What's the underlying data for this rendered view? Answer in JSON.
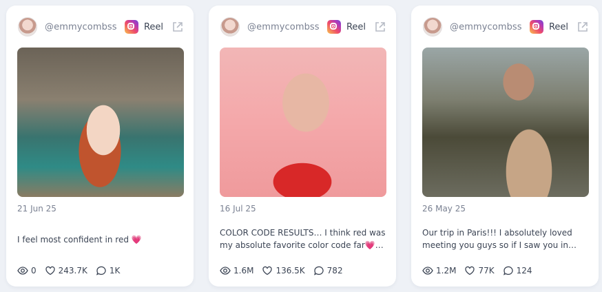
{
  "posts": [
    {
      "handle": "@emmycombss",
      "type": "Reel",
      "date": "21 Jun 25",
      "caption": "I feel most confident in red 💗",
      "views": "0",
      "likes": "243.7K",
      "comments": "1K"
    },
    {
      "handle": "@emmycombss",
      "type": "Reel",
      "date": "16 Jul 25",
      "caption": "COLOR CODE RESULTS… I think red was my absolute favorite color code far💗 😻 Th…",
      "views": "1.6M",
      "likes": "136.5K",
      "comments": "782"
    },
    {
      "handle": "@emmycombss",
      "type": "Reel",
      "date": "26 May 25",
      "caption": "Our trip in Paris!!! I absolutely loved meeting you guys so if I saw you in Paris…",
      "views": "1.2M",
      "likes": "77K",
      "comments": "124"
    }
  ]
}
